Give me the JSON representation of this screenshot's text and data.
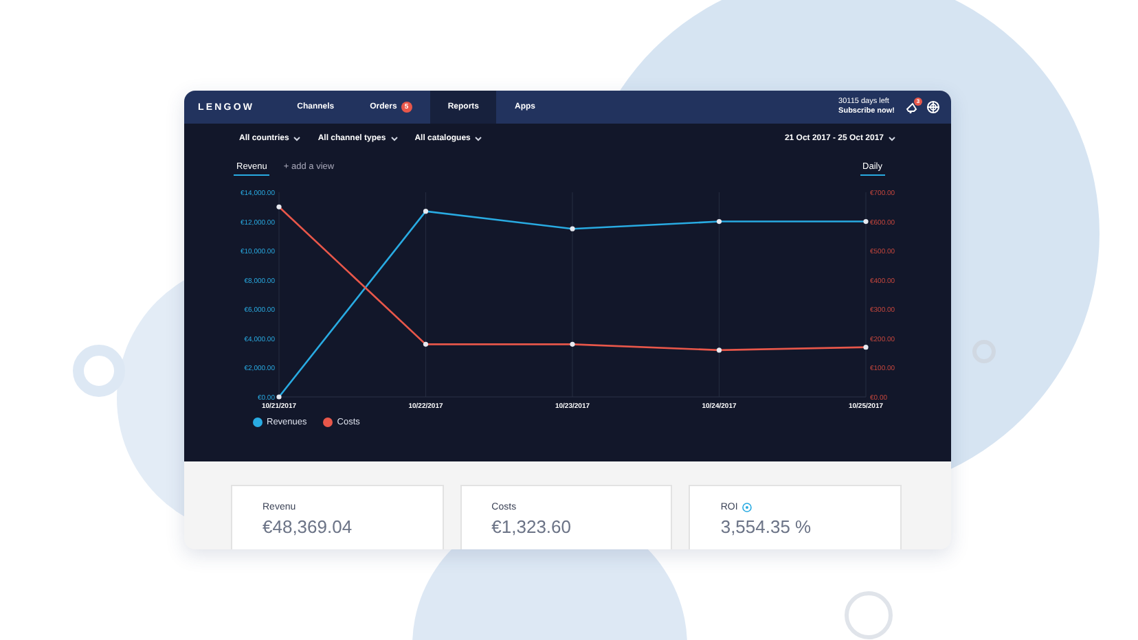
{
  "nav": {
    "logo": "LENGOW",
    "items": [
      {
        "label": "Channels",
        "selected": false
      },
      {
        "label": "Orders",
        "selected": false,
        "badge": "5"
      },
      {
        "label": "Reports",
        "selected": true
      },
      {
        "label": "Apps",
        "selected": false
      }
    ],
    "trial": {
      "days_left": "30115 days left",
      "cta": "Subscribe now!"
    },
    "notifications_badge": "3"
  },
  "filters": [
    {
      "label": "All countries"
    },
    {
      "label": "All channel types"
    },
    {
      "label": "All catalogues"
    }
  ],
  "date_range": "21 Oct 2017 - 25 Oct 2017",
  "views": [
    {
      "label": "Revenu",
      "selected": true
    },
    {
      "label": "+ add a view",
      "selected": false
    }
  ],
  "granularity": {
    "label": "Daily",
    "selected": true
  },
  "chart": {
    "chart_data": {
      "type": "line",
      "categories": [
        "10/21/2017",
        "10/22/2017",
        "10/23/2017",
        "10/24/2017",
        "10/25/2017"
      ],
      "series": [
        {
          "name": "Revenues",
          "color": "#29abe2",
          "marker": true,
          "values": [
            0,
            12700,
            11500,
            12000,
            12000
          ]
        },
        {
          "name": "Costs",
          "color": "#e8574a",
          "axis": "y2",
          "marker": true,
          "values": [
            650,
            180,
            180,
            160,
            170
          ]
        }
      ],
      "grid": true,
      "ylim": [
        0,
        14000
      ],
      "yticks": [
        {
          "value": 0,
          "label": "€0.00"
        },
        {
          "value": 2000,
          "label": "€2,000.00"
        },
        {
          "value": 4000,
          "label": "€4,000.00"
        },
        {
          "value": 6000,
          "label": "€6,000.00"
        },
        {
          "value": 8000,
          "label": "€8,000.00"
        },
        {
          "value": 10000,
          "label": "€10,000.00"
        },
        {
          "value": 12000,
          "label": "€12,000.00"
        },
        {
          "value": 14000,
          "label": "€14,000.00"
        }
      ],
      "y2lim": [
        0,
        700
      ],
      "y2ticks": [
        {
          "value": 0,
          "label": "€0.00"
        },
        {
          "value": 100,
          "label": "€100.00"
        },
        {
          "value": 200,
          "label": "€200.00"
        },
        {
          "value": 300,
          "label": "€300.00"
        },
        {
          "value": 400,
          "label": "€400.00"
        },
        {
          "value": 500,
          "label": "€500.00"
        },
        {
          "value": 600,
          "label": "€600.00"
        },
        {
          "value": 700,
          "label": "€700.00"
        }
      ]
    }
  },
  "cards": [
    {
      "label": "Revenu",
      "value": "€48,369.04",
      "help": false
    },
    {
      "label": "Costs",
      "value": "€1,323.60",
      "help": false
    },
    {
      "label": "ROI",
      "value": "3,554.35 %",
      "help": true
    }
  ]
}
